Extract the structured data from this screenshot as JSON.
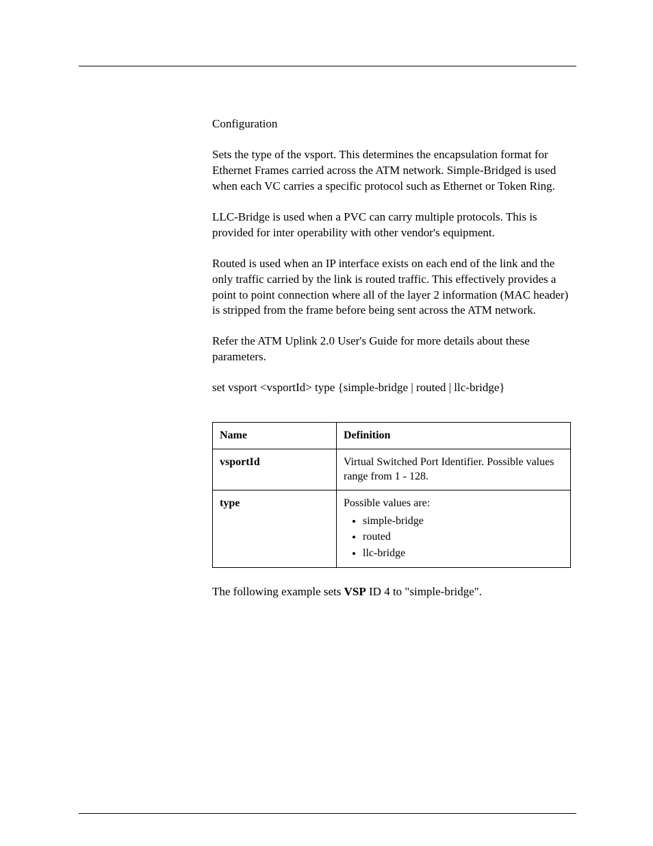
{
  "mode_line": "Configuration",
  "para1": "Sets the type of the vsport. This determines the encapsulation format for Ethernet Frames carried across the ATM network. Simple-Bridged is used when each VC carries a specific protocol such as Ethernet or Token Ring.",
  "para2": "LLC-Bridge is used when a PVC can carry multiple protocols. This is provided for inter operability with other vendor's equipment.",
  "para3": "Routed is used when an IP interface exists on each end of the link and the only traffic carried by the link is routed traffic. This effectively provides a point to point connection where all of the layer 2 information (MAC header) is stripped from the frame before being sent across the ATM network.",
  "para4": "Refer the ATM Uplink 2.0 User's Guide for more details about these parameters.",
  "syntax": "set vsport <vsportId> type {simple-bridge | routed | llc-bridge}",
  "table": {
    "headers": {
      "name": "Name",
      "definition": "Definition"
    },
    "rows": [
      {
        "name": "vsportId",
        "definition": "Virtual Switched Port Identifier. Possible values range from 1 - 128."
      },
      {
        "name": "type",
        "definition_intro": "Possible values are:",
        "bullets": [
          "simple-bridge",
          "routed",
          "llc-bridge"
        ]
      }
    ]
  },
  "example_pre": "The following example sets ",
  "example_bold": "VSP",
  "example_post": " ID 4 to \"simple-bridge\"."
}
